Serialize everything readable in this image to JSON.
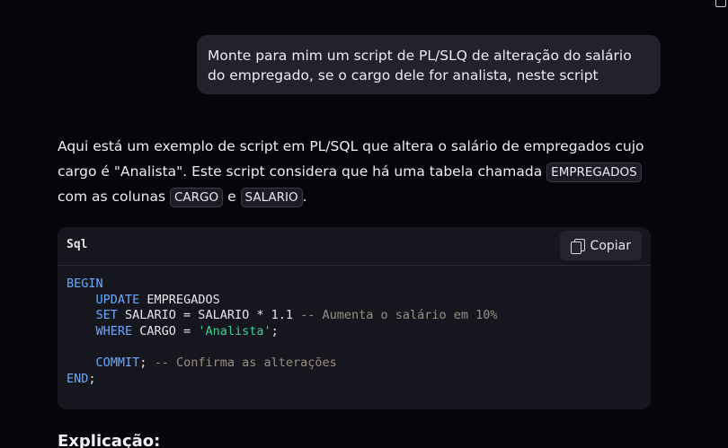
{
  "user_message": "Monte para mim um script de PL/SLQ de alteração do salário do empregado, se o cargo dele for analista, neste script",
  "answer": {
    "t1": "Aqui está um exemplo de script em PL/SQL que altera o salário de empregados cujo cargo é \"Analista\". Este script considera que há uma tabela chamada ",
    "code1": "EMPREGADOS",
    "t2": " com as colunas ",
    "code2": "CARGO",
    "t3": " e ",
    "code3": "SALARIO",
    "t4": "."
  },
  "code_block": {
    "language": "Sql",
    "copy_label": "Copiar",
    "lines": {
      "l1": "BEGIN",
      "l2_kw": "UPDATE",
      "l2_rest": " EMPREGADOS",
      "l3_kw": "SET",
      "l3_rest": " SALARIO = SALARIO * 1.1 ",
      "l3_comment": "-- Aumenta o salário em 10%",
      "l4_kw": "WHERE",
      "l4_rest": " CARGO = ",
      "l4_str": "'Analista'",
      "l4_end": ";",
      "l6_kw": "COMMIT",
      "l6_rest": "; ",
      "l6_comment": "-- Confirma as alterações",
      "l7_kw": "END",
      "l7_rest": ";"
    }
  },
  "next_heading": "Explicação:"
}
